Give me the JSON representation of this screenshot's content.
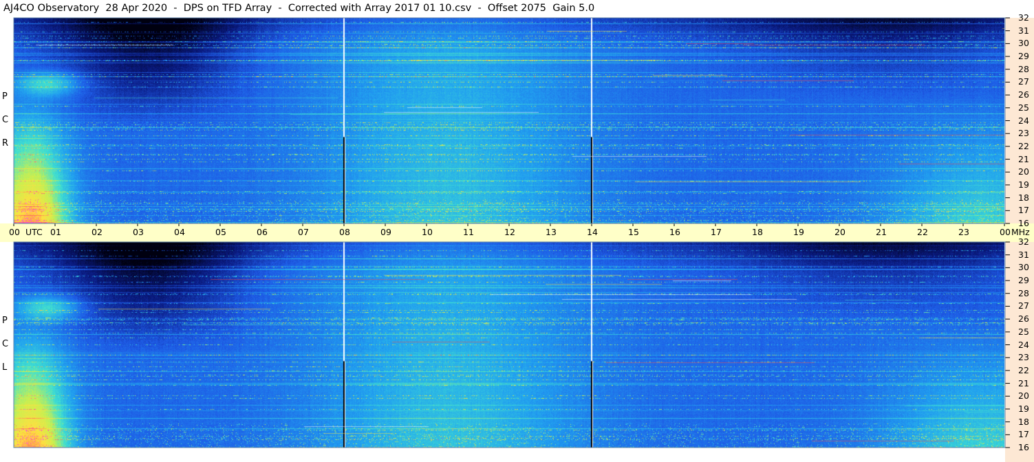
{
  "title": "AJ4CO Observatory  28 Apr 2020  -  DPS on TFD Array  -  Corrected with Array 2017 01 10.csv  -  Offset 2075  Gain 5.0",
  "panels": [
    {
      "name": "top",
      "side_letters": [
        "R",
        "C",
        "P"
      ]
    },
    {
      "name": "bottom",
      "side_letters": [
        "L",
        "C",
        "P"
      ]
    }
  ],
  "time_axis": {
    "labels": [
      "00",
      "01",
      "02",
      "03",
      "04",
      "05",
      "06",
      "07",
      "08",
      "09",
      "10",
      "11",
      "12",
      "13",
      "14",
      "15",
      "16",
      "17",
      "18",
      "19",
      "20",
      "21",
      "22",
      "23",
      "00"
    ],
    "utc_label": "UTC",
    "unit_label": "MHz"
  },
  "colors": {
    "time_band": "#ffffc8",
    "right_margin": "#fde8d4"
  },
  "chart_data": {
    "type": "heatmap",
    "title": "AJ4CO Observatory  28 Apr 2020  -  DPS on TFD Array  -  Corrected with Array 2017 01 10.csv  -  Offset 2075  Gain 5.0",
    "x_axis": {
      "label": "UTC",
      "range": [
        "00",
        "00"
      ],
      "ticks": [
        "00",
        "01",
        "02",
        "03",
        "04",
        "05",
        "06",
        "07",
        "08",
        "09",
        "10",
        "11",
        "12",
        "13",
        "14",
        "15",
        "16",
        "17",
        "18",
        "19",
        "20",
        "21",
        "22",
        "23",
        "00"
      ]
    },
    "y_axis": {
      "label": "MHz",
      "range": [
        16,
        32
      ],
      "ticks": [
        16,
        17,
        18,
        19,
        20,
        21,
        22,
        23,
        24,
        25,
        26,
        27,
        28,
        29,
        30,
        31,
        32
      ]
    },
    "channels": [
      "RCP",
      "LCP"
    ],
    "markers_utc": [
      8,
      14
    ],
    "colormap": [
      "#000010",
      "#0a1a80",
      "#1e5ae6",
      "#21a0f0",
      "#40e0d0",
      "#c8f050",
      "#ffe040",
      "#ff6060",
      "#ff40ff"
    ]
  }
}
